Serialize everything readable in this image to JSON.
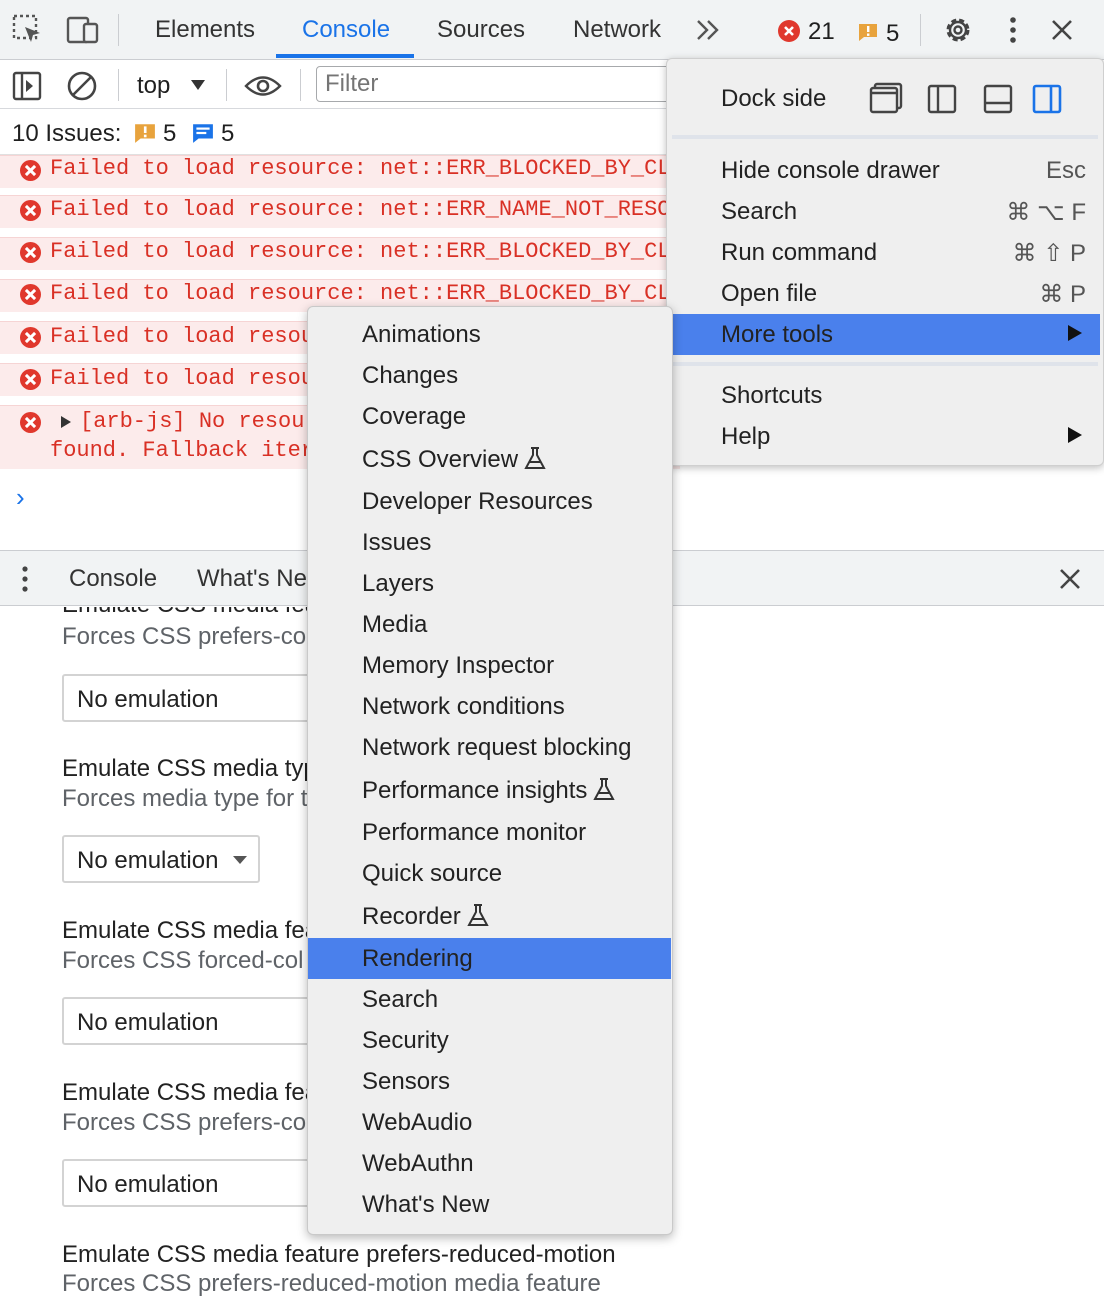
{
  "devtools_tabs": [
    "Elements",
    "Console",
    "Sources",
    "Network"
  ],
  "active_tab": "Console",
  "counts": {
    "errors": "21",
    "warnings": "5"
  },
  "console_toolbar": {
    "context": "top",
    "filter_placeholder": "Filter"
  },
  "issues_bar": {
    "label": "10 Issues:",
    "warnings": "5",
    "info": "5"
  },
  "console_messages": [
    "Failed to load resource: net::ERR_BLOCKED_BY_CL",
    "Failed to load resource: net::ERR_NAME_NOT_RESO",
    "Failed to load resource: net::ERR_BLOCKED_BY_CL",
    "Failed to load resource: net::ERR_BLOCKED_BY_CL",
    "Failed to load resou",
    "Failed to load resou"
  ],
  "expandable_message": {
    "line1": "[arb-js] No resou",
    "line2": "found. Fallback iter"
  },
  "prompt_symbol": "›",
  "drawer": {
    "tabs": [
      "Console",
      "What's Ne"
    ],
    "settings": [
      {
        "title": "Emulate CSS media fea",
        "desc": "Forces CSS prefers-co",
        "value": "No emulation"
      },
      {
        "title": "Emulate CSS media typ",
        "desc": "Forces media type for t",
        "value": "No emulation"
      },
      {
        "title": "Emulate CSS media fea",
        "desc": "Forces CSS forced-col",
        "value": "No emulation"
      },
      {
        "title": "Emulate CSS media fea",
        "desc": "Forces CSS prefers-co",
        "value": "No emulation"
      }
    ],
    "last_setting": {
      "title": "Emulate CSS media feature prefers-reduced-motion",
      "desc": "Forces CSS prefers-reduced-motion media feature"
    }
  },
  "main_menu": {
    "dock_side_label": "Dock side",
    "items": [
      {
        "label": "Hide console drawer",
        "shortcut": "Esc"
      },
      {
        "label": "Search",
        "shortcut": "⌘ ⌥ F"
      },
      {
        "label": "Run command",
        "shortcut": "⌘ ⇧ P"
      },
      {
        "label": "Open file",
        "shortcut": "⌘ P"
      },
      {
        "label": "More tools",
        "shortcut": ""
      }
    ],
    "items2": [
      {
        "label": "Shortcuts"
      },
      {
        "label": "Help"
      }
    ],
    "highlighted": "More tools"
  },
  "more_tools_menu": {
    "items": [
      "Animations",
      "Changes",
      "Coverage",
      "CSS Overview",
      "Developer Resources",
      "Issues",
      "Layers",
      "Media",
      "Memory Inspector",
      "Network conditions",
      "Network request blocking",
      "Performance insights",
      "Performance monitor",
      "Quick source",
      "Recorder",
      "Rendering",
      "Search",
      "Security",
      "Sensors",
      "WebAudio",
      "WebAuthn",
      "What's New"
    ],
    "experimental": [
      "CSS Overview",
      "Performance insights",
      "Recorder"
    ],
    "highlighted": "Rendering"
  },
  "colors": {
    "accent": "#1a73e8",
    "highlight": "#4a80ec",
    "error": "#d93025",
    "warning": "#e8a33d"
  }
}
